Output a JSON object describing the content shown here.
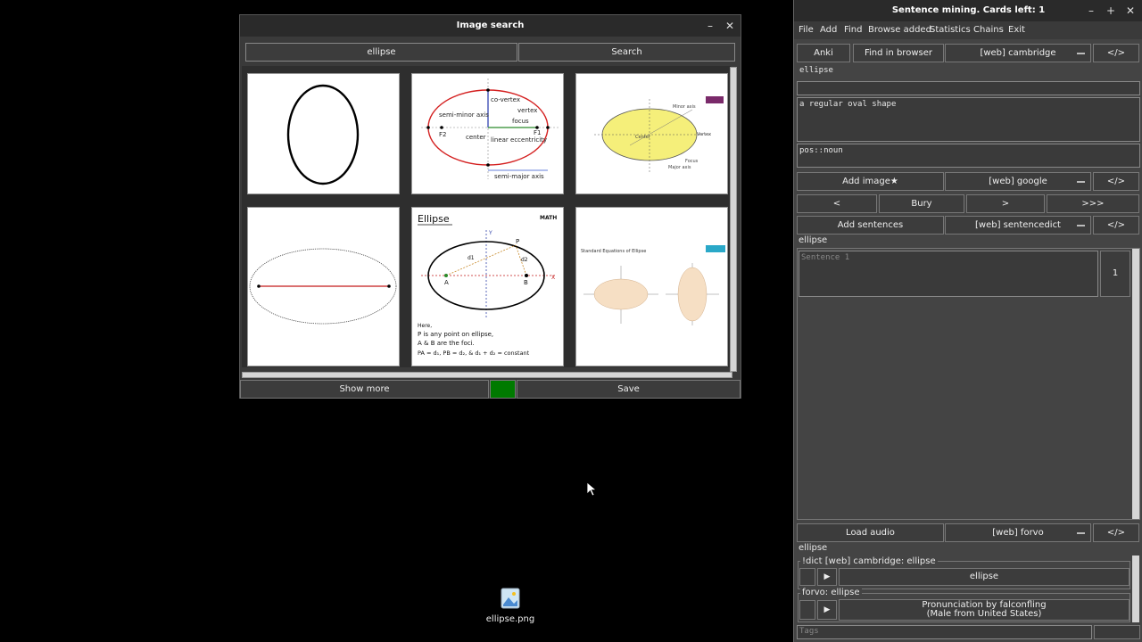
{
  "image_dialog": {
    "title": "Image search",
    "query_value": "ellipse",
    "search_label": "Search",
    "show_more_label": "Show more",
    "save_label": "Save",
    "minimize_glyph": "–",
    "close_glyph": "✕",
    "results": [
      {
        "kind": "simple-vertical-ellipse"
      },
      {
        "kind": "labeled-ellipse-diagram",
        "labels": [
          "co-vertex",
          "semi-minor axis",
          "vertex",
          "focus",
          "F2",
          "F1",
          "center",
          "linear eccentricity",
          "semi-major axis"
        ]
      },
      {
        "kind": "yellow-ellipse-diagram",
        "labels": [
          "Minor axis",
          "Vertex",
          "Center",
          "Focus",
          "Major axis"
        ]
      },
      {
        "kind": "thin-ellipse-with-axis"
      },
      {
        "kind": "ellipse-definition-card",
        "title": "Ellipse",
        "brand": "MATH",
        "point_labels": [
          "P",
          "d1",
          "d2",
          "A",
          "B",
          "X",
          "Y"
        ],
        "notes": [
          "Here,",
          "P is any point on ellipse,",
          "A & B are the foci.",
          "PA = d₁, PB = d₂, & d₁ + d₂ = constant"
        ]
      },
      {
        "kind": "standard-equations-card",
        "title": "Standard Equations of Ellipse"
      }
    ]
  },
  "side_panel": {
    "title": "Sentence mining. Cards left: 1",
    "menu": [
      "File",
      "Add",
      "Find",
      "Browse added",
      "Statistics",
      "Chains",
      "Exit"
    ],
    "anki_label": "Anki",
    "find_in_browser_label": "Find in browser",
    "dict_source": "[web] cambridge",
    "code_label": "</>",
    "word_value": "ellipse",
    "second_field_value": "",
    "definition_value": "a regular oval shape",
    "tags_field_value": "pos::noun",
    "add_image_label": "Add image★",
    "image_source": "[web] google",
    "nav_prev": "<",
    "nav_bury": "Bury",
    "nav_next": ">",
    "nav_skip": ">>>",
    "add_sentences_label": "Add sentences",
    "sentence_source": "[web] sentencedict",
    "sentence_word": "ellipse",
    "sentence_placeholder": "Sentence 1",
    "sentence_count": "1",
    "load_audio_label": "Load audio",
    "audio_source": "[web] forvo",
    "audio_word": "ellipse",
    "audio_group1_title": "!dict [web] cambridge: ellipse",
    "audio_group1_item": "ellipse",
    "audio_group2_title": "forvo: ellipse",
    "audio_group2_item_line1": "Pronunciation by falconfling",
    "audio_group2_item_line2": "(Male from United States)",
    "tags_placeholder": "Tags",
    "play_glyph": "▶"
  },
  "desktop": {
    "file_icon_label": "ellipse.png"
  },
  "colors": {
    "accent_green": "#007a00",
    "ellipse_red": "#d42020",
    "ellipse_yellow": "#f5ef7a"
  }
}
